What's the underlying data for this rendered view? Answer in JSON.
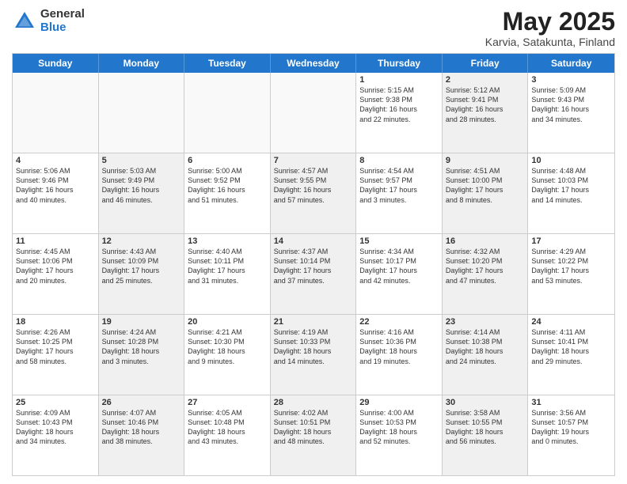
{
  "logo": {
    "general": "General",
    "blue": "Blue"
  },
  "title": {
    "month": "May 2025",
    "location": "Karvia, Satakunta, Finland"
  },
  "weekdays": [
    "Sunday",
    "Monday",
    "Tuesday",
    "Wednesday",
    "Thursday",
    "Friday",
    "Saturday"
  ],
  "rows": [
    [
      {
        "day": "",
        "info": "",
        "empty": true
      },
      {
        "day": "",
        "info": "",
        "empty": true
      },
      {
        "day": "",
        "info": "",
        "empty": true
      },
      {
        "day": "",
        "info": "",
        "empty": true
      },
      {
        "day": "1",
        "info": "Sunrise: 5:15 AM\nSunset: 9:38 PM\nDaylight: 16 hours\nand 22 minutes.",
        "shaded": false
      },
      {
        "day": "2",
        "info": "Sunrise: 5:12 AM\nSunset: 9:41 PM\nDaylight: 16 hours\nand 28 minutes.",
        "shaded": true
      },
      {
        "day": "3",
        "info": "Sunrise: 5:09 AM\nSunset: 9:43 PM\nDaylight: 16 hours\nand 34 minutes.",
        "shaded": false
      }
    ],
    [
      {
        "day": "4",
        "info": "Sunrise: 5:06 AM\nSunset: 9:46 PM\nDaylight: 16 hours\nand 40 minutes.",
        "shaded": false
      },
      {
        "day": "5",
        "info": "Sunrise: 5:03 AM\nSunset: 9:49 PM\nDaylight: 16 hours\nand 46 minutes.",
        "shaded": true
      },
      {
        "day": "6",
        "info": "Sunrise: 5:00 AM\nSunset: 9:52 PM\nDaylight: 16 hours\nand 51 minutes.",
        "shaded": false
      },
      {
        "day": "7",
        "info": "Sunrise: 4:57 AM\nSunset: 9:55 PM\nDaylight: 16 hours\nand 57 minutes.",
        "shaded": true
      },
      {
        "day": "8",
        "info": "Sunrise: 4:54 AM\nSunset: 9:57 PM\nDaylight: 17 hours\nand 3 minutes.",
        "shaded": false
      },
      {
        "day": "9",
        "info": "Sunrise: 4:51 AM\nSunset: 10:00 PM\nDaylight: 17 hours\nand 8 minutes.",
        "shaded": true
      },
      {
        "day": "10",
        "info": "Sunrise: 4:48 AM\nSunset: 10:03 PM\nDaylight: 17 hours\nand 14 minutes.",
        "shaded": false
      }
    ],
    [
      {
        "day": "11",
        "info": "Sunrise: 4:45 AM\nSunset: 10:06 PM\nDaylight: 17 hours\nand 20 minutes.",
        "shaded": false
      },
      {
        "day": "12",
        "info": "Sunrise: 4:43 AM\nSunset: 10:09 PM\nDaylight: 17 hours\nand 25 minutes.",
        "shaded": true
      },
      {
        "day": "13",
        "info": "Sunrise: 4:40 AM\nSunset: 10:11 PM\nDaylight: 17 hours\nand 31 minutes.",
        "shaded": false
      },
      {
        "day": "14",
        "info": "Sunrise: 4:37 AM\nSunset: 10:14 PM\nDaylight: 17 hours\nand 37 minutes.",
        "shaded": true
      },
      {
        "day": "15",
        "info": "Sunrise: 4:34 AM\nSunset: 10:17 PM\nDaylight: 17 hours\nand 42 minutes.",
        "shaded": false
      },
      {
        "day": "16",
        "info": "Sunrise: 4:32 AM\nSunset: 10:20 PM\nDaylight: 17 hours\nand 47 minutes.",
        "shaded": true
      },
      {
        "day": "17",
        "info": "Sunrise: 4:29 AM\nSunset: 10:22 PM\nDaylight: 17 hours\nand 53 minutes.",
        "shaded": false
      }
    ],
    [
      {
        "day": "18",
        "info": "Sunrise: 4:26 AM\nSunset: 10:25 PM\nDaylight: 17 hours\nand 58 minutes.",
        "shaded": false
      },
      {
        "day": "19",
        "info": "Sunrise: 4:24 AM\nSunset: 10:28 PM\nDaylight: 18 hours\nand 3 minutes.",
        "shaded": true
      },
      {
        "day": "20",
        "info": "Sunrise: 4:21 AM\nSunset: 10:30 PM\nDaylight: 18 hours\nand 9 minutes.",
        "shaded": false
      },
      {
        "day": "21",
        "info": "Sunrise: 4:19 AM\nSunset: 10:33 PM\nDaylight: 18 hours\nand 14 minutes.",
        "shaded": true
      },
      {
        "day": "22",
        "info": "Sunrise: 4:16 AM\nSunset: 10:36 PM\nDaylight: 18 hours\nand 19 minutes.",
        "shaded": false
      },
      {
        "day": "23",
        "info": "Sunrise: 4:14 AM\nSunset: 10:38 PM\nDaylight: 18 hours\nand 24 minutes.",
        "shaded": true
      },
      {
        "day": "24",
        "info": "Sunrise: 4:11 AM\nSunset: 10:41 PM\nDaylight: 18 hours\nand 29 minutes.",
        "shaded": false
      }
    ],
    [
      {
        "day": "25",
        "info": "Sunrise: 4:09 AM\nSunset: 10:43 PM\nDaylight: 18 hours\nand 34 minutes.",
        "shaded": false
      },
      {
        "day": "26",
        "info": "Sunrise: 4:07 AM\nSunset: 10:46 PM\nDaylight: 18 hours\nand 38 minutes.",
        "shaded": true
      },
      {
        "day": "27",
        "info": "Sunrise: 4:05 AM\nSunset: 10:48 PM\nDaylight: 18 hours\nand 43 minutes.",
        "shaded": false
      },
      {
        "day": "28",
        "info": "Sunrise: 4:02 AM\nSunset: 10:51 PM\nDaylight: 18 hours\nand 48 minutes.",
        "shaded": true
      },
      {
        "day": "29",
        "info": "Sunrise: 4:00 AM\nSunset: 10:53 PM\nDaylight: 18 hours\nand 52 minutes.",
        "shaded": false
      },
      {
        "day": "30",
        "info": "Sunrise: 3:58 AM\nSunset: 10:55 PM\nDaylight: 18 hours\nand 56 minutes.",
        "shaded": true
      },
      {
        "day": "31",
        "info": "Sunrise: 3:56 AM\nSunset: 10:57 PM\nDaylight: 19 hours\nand 0 minutes.",
        "shaded": false
      }
    ]
  ]
}
